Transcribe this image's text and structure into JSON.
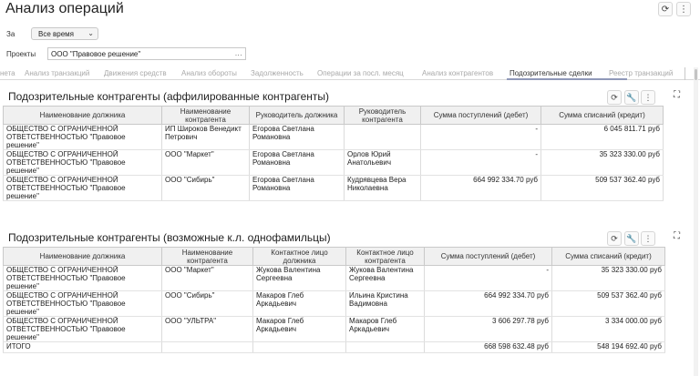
{
  "header": {
    "title": "Анализ операций",
    "refresh_icon": "refresh-icon",
    "more_icon": "more-vertical-icon"
  },
  "filters": {
    "period_label": "За",
    "period_value": "Все время",
    "projects_label": "Проекты",
    "projects_value": "ООО \"Правовое решение\"",
    "projects_picker": "..."
  },
  "tabs": [
    {
      "label": "нета"
    },
    {
      "label": "Анализ транзакций"
    },
    {
      "label": "Движения средств"
    },
    {
      "label": "Анализ обороты"
    },
    {
      "label": "Задолженность"
    },
    {
      "label": "Операции за посл. месяц"
    },
    {
      "label": "Анализ контрагентов"
    },
    {
      "label": "Подозрительные сделки"
    },
    {
      "label": "Реестр транзакций"
    }
  ],
  "active_tab": "Подозрительные сделки",
  "section1": {
    "title": "Подозрительные контрагенты (аффилированные контрагенты)",
    "columns": [
      "Наименование должника",
      "Наименование контрагента",
      "Руководитель должника",
      "Руководитель контрагента",
      "Сумма поступлений (дебет)",
      "Сумма списаний (кредит)"
    ],
    "rows": [
      {
        "debtor": "ОБЩЕСТВО С ОГРАНИЧЕННОЙ ОТВЕТСТВЕННОСТЬЮ \"Правовое решение\"",
        "counterparty": "ИП Широков Венедикт Петрович",
        "debtor_head": "Егорова Светлана Романовна",
        "cp_head": "",
        "debit": "-",
        "credit": "6 045 811.71 руб"
      },
      {
        "debtor": "ОБЩЕСТВО С ОГРАНИЧЕННОЙ ОТВЕТСТВЕННОСТЬЮ \"Правовое решение\"",
        "counterparty": "ООО \"Маркет\"",
        "debtor_head": "Егорова Светлана Романовна",
        "cp_head": "Орлов Юрий Анатольевич",
        "debit": "-",
        "credit": "35 323 330.00 руб"
      },
      {
        "debtor": "ОБЩЕСТВО С ОГРАНИЧЕННОЙ ОТВЕТСТВЕННОСТЬЮ \"Правовое решение\"",
        "counterparty": "ООО \"Сибирь\"",
        "debtor_head": "Егорова Светлана Романовна",
        "cp_head": "Кудрявцева Вера Николаевна",
        "debit": "664 992 334.70 руб",
        "credit": "509 537 362.40 руб"
      }
    ]
  },
  "section2": {
    "title": "Подозрительные контрагенты (возможные к.л. однофамильцы)",
    "columns": [
      "Наименование должника",
      "Наименование контрагента",
      "Контактное лицо должника",
      "Контактное лицо контрагента",
      "Сумма поступлений (дебет)",
      "Сумма списаний (кредит)"
    ],
    "rows": [
      {
        "debtor": "ОБЩЕСТВО С ОГРАНИЧЕННОЙ ОТВЕТСТВЕННОСТЬЮ \"Правовое решение\"",
        "counterparty": "ООО \"Маркет\"",
        "debtor_contact": "Жукова Валентина Сергеевна",
        "cp_contact": "Жукова Валентина Сергеевна",
        "debit": "-",
        "credit": "35 323 330.00 руб"
      },
      {
        "debtor": "ОБЩЕСТВО С ОГРАНИЧЕННОЙ ОТВЕТСТВЕННОСТЬЮ \"Правовое решение\"",
        "counterparty": "ООО \"Сибирь\"",
        "debtor_contact": "Макаров Глеб Аркадьевич",
        "cp_contact": "Ильина Кристина Вадимовна",
        "debit": "664 992 334.70 руб",
        "credit": "509 537 362.40 руб"
      },
      {
        "debtor": "ОБЩЕСТВО С ОГРАНИЧЕННОЙ ОТВЕТСТВЕННОСТЬЮ \"Правовое решение\"",
        "counterparty": "ООО \"УЛЬТРА\"",
        "debtor_contact": "Макаров Глеб Аркадьевич",
        "cp_contact": "Макаров Глеб Аркадьевич",
        "debit": "3 606 297.78 руб",
        "credit": "3 334 000.00 руб"
      }
    ],
    "total": {
      "label": "ИТОГО",
      "debit": "668 598 632.48 руб",
      "credit": "548 194 692.40 руб"
    }
  },
  "icons": {
    "settings": "wrench-icon",
    "expand": "expand-icon"
  },
  "colors": {
    "tab_underline": "#8f98b8",
    "header_bg": "#f0f0f0"
  }
}
